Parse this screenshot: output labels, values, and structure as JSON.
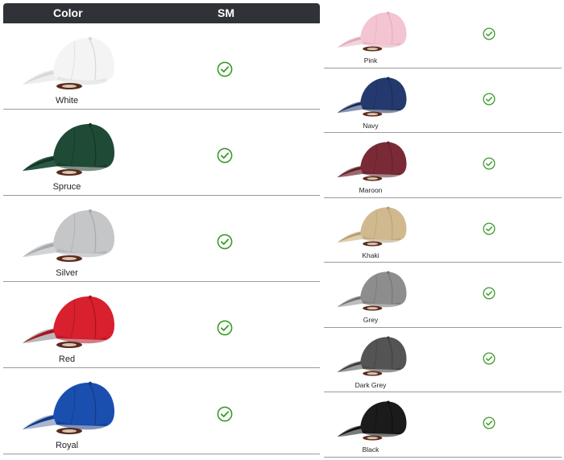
{
  "header": {
    "color_label": "Color",
    "size_label": "SM"
  },
  "accent_colors": {
    "header_bg": "#2f3338",
    "check": "#3a9a2a"
  },
  "icons": {
    "available": "check-circle-icon"
  },
  "left_rows": [
    {
      "name": "White",
      "available": true,
      "cap_color": "#f4f4f4",
      "shade": "#d9d9d9",
      "under": "#eeeeee"
    },
    {
      "name": "Spruce",
      "available": true,
      "cap_color": "#1f4a35",
      "shade": "#163626",
      "under": "#2a5a43"
    },
    {
      "name": "Silver",
      "available": true,
      "cap_color": "#c5c6c8",
      "shade": "#a9aaad",
      "under": "#d3d4d6"
    },
    {
      "name": "Red",
      "available": true,
      "cap_color": "#d8202e",
      "shade": "#a9141f",
      "under": "#b8b8b8"
    },
    {
      "name": "Royal",
      "available": true,
      "cap_color": "#1a4fb0",
      "shade": "#133a85",
      "under": "#a8b6cf"
    }
  ],
  "right_rows": [
    {
      "name": "Pink",
      "available": true,
      "cap_color": "#f3c4d2",
      "shade": "#e0a9ba",
      "under": "#f0d4dd"
    },
    {
      "name": "Navy",
      "available": true,
      "cap_color": "#243a6e",
      "shade": "#1a2b52",
      "under": "#8a96b0"
    },
    {
      "name": "Maroon",
      "available": true,
      "cap_color": "#7a2a36",
      "shade": "#5c1f28",
      "under": "#9a6870"
    },
    {
      "name": "Khaki",
      "available": true,
      "cap_color": "#d1b98f",
      "shade": "#b59c72",
      "under": "#e0cfae"
    },
    {
      "name": "Grey",
      "available": true,
      "cap_color": "#8d8d8e",
      "shade": "#6f6f70",
      "under": "#bdbdbd"
    },
    {
      "name": "Dark Grey",
      "available": true,
      "cap_color": "#555455",
      "shade": "#3d3c3d",
      "under": "#9a9a9a"
    },
    {
      "name": "Black",
      "available": true,
      "cap_color": "#1b1b1b",
      "shade": "#0d0d0d",
      "under": "#7a7a7a"
    }
  ]
}
